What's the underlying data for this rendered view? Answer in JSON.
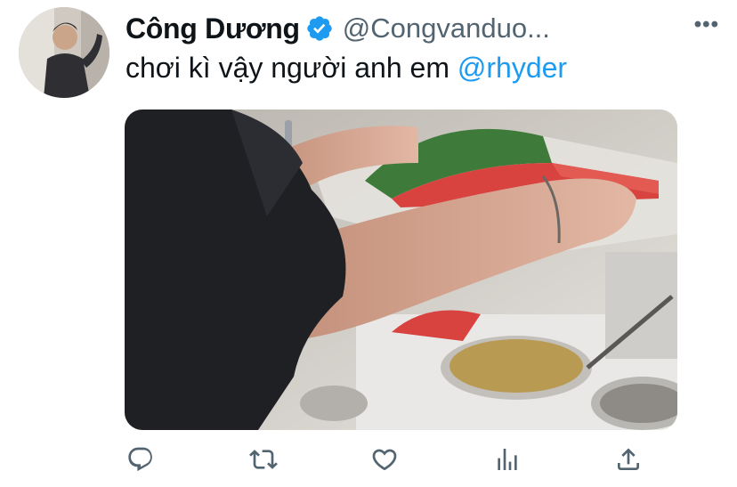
{
  "tweet": {
    "author": {
      "display_name": "Công Dương",
      "handle": "@Congvanduo...",
      "verified": true,
      "avatar_icon": "profile-photo"
    },
    "more_label": "•••",
    "text_prefix": "chơi kì vậy người anh em ",
    "mention": "@rhyder",
    "media": {
      "type": "video-thumbnail",
      "icon": "video-frame"
    },
    "actions": [
      {
        "name": "reply-icon"
      },
      {
        "name": "retweet-icon"
      },
      {
        "name": "like-icon"
      },
      {
        "name": "analytics-icon"
      },
      {
        "name": "share-icon"
      }
    ]
  },
  "colors": {
    "text": "#0f1419",
    "secondary": "#536471",
    "accent": "#1d9bf0"
  }
}
